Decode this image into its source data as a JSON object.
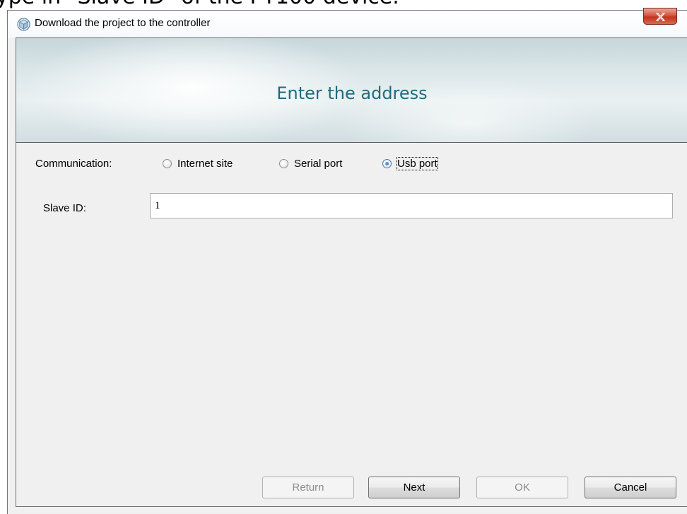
{
  "caption": "ype in \"Slave ID\" of the PT100 device.",
  "window": {
    "title": "Download the project to the controller",
    "close_icon": "close-icon",
    "close_color": "#c23420"
  },
  "banner": {
    "title": "Enter the address",
    "title_color": "#1f6b7e"
  },
  "communication": {
    "label": "Communication:",
    "options": [
      {
        "label": "Internet site",
        "checked": false
      },
      {
        "label": "Serial port",
        "checked": false
      },
      {
        "label": "Usb port",
        "checked": true
      }
    ]
  },
  "slave": {
    "label": "Slave ID:",
    "value": "1"
  },
  "buttons": {
    "return": "Return",
    "next": "Next",
    "ok": "OK",
    "cancel": "Cancel"
  }
}
